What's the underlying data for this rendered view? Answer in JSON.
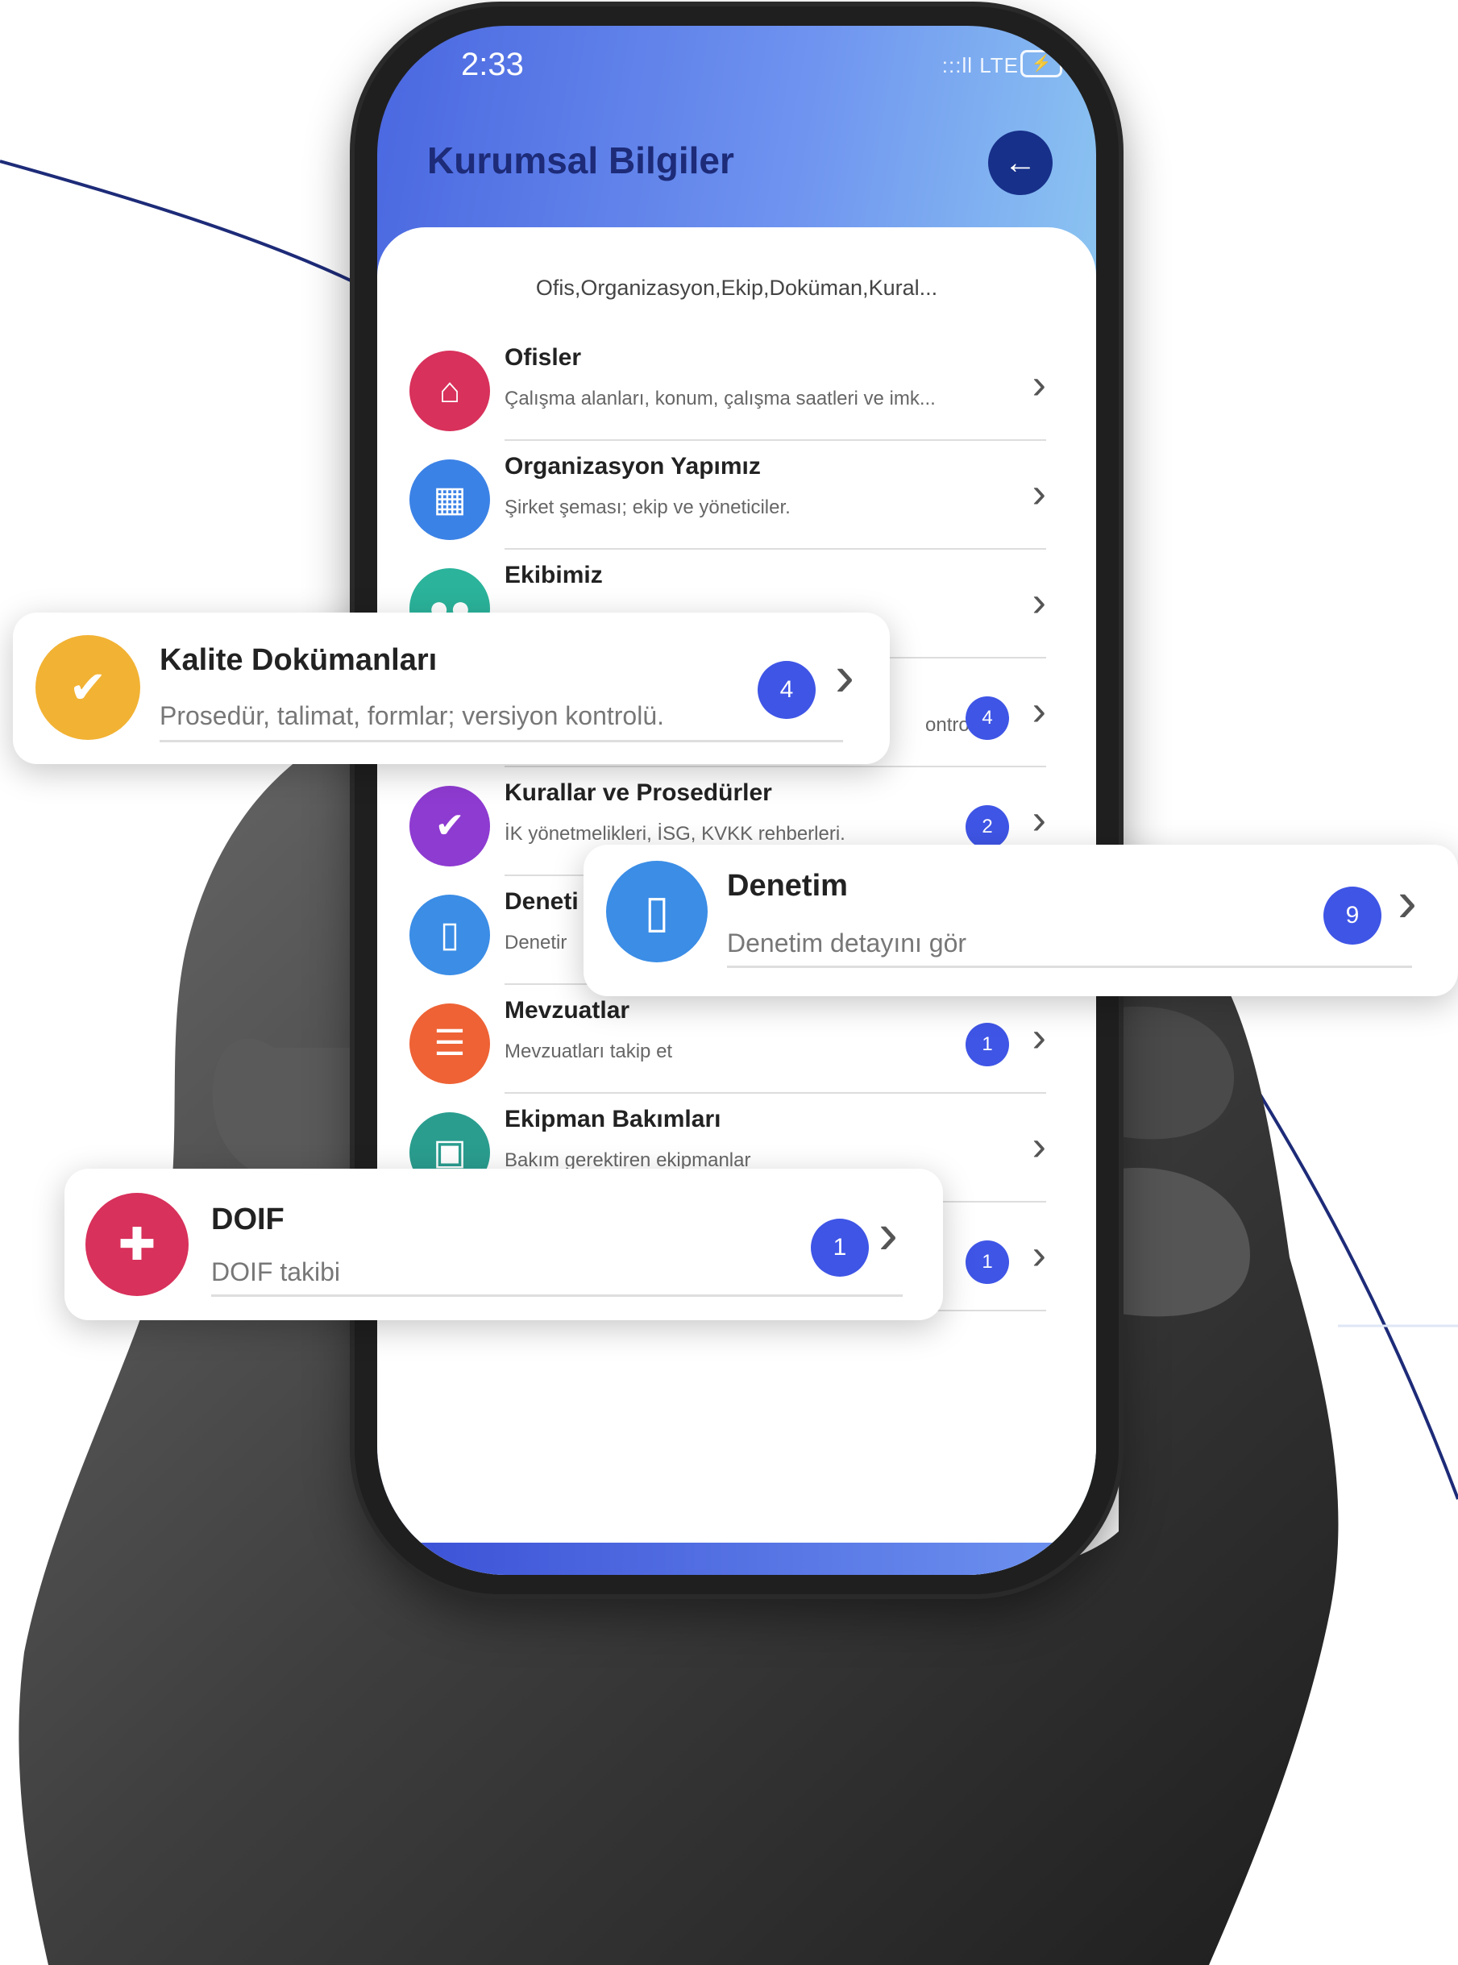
{
  "status_bar": {
    "time": "2:33",
    "signal": ":::ll LTE",
    "battery": "⚡"
  },
  "header": {
    "title": "Kurumsal Bilgiler",
    "back_icon": "←"
  },
  "subtitle": "Ofis,Organizasyon,Ekip,Doküman,Kural...",
  "menu": [
    {
      "title": "Ofisler",
      "desc": "Çalışma alanları, konum, çalışma saatleri ve imk...",
      "icon": "home-icon",
      "color": "#d8315b"
    },
    {
      "title": "Organizasyon Yapımız",
      "desc": "Şirket şeması; ekip ve yöneticiler.",
      "icon": "building-icon",
      "color": "#3b82e6"
    },
    {
      "title": "Ekibimiz",
      "desc": "",
      "icon": "people-icon",
      "color": "#2bb39b"
    },
    {
      "title": "",
      "desc": "ontrolü.",
      "badge": "4",
      "icon": "",
      "color": "#f2b233"
    },
    {
      "title": "Kurallar ve Prosedürler",
      "desc": "İK yönetmelikleri, İSG, KVKK rehberleri.",
      "badge": "2",
      "icon": "check-badge-icon",
      "color": "#8e3bd1"
    },
    {
      "title": "Deneti",
      "desc": "Denetir",
      "icon": "tablet-icon",
      "color": "#3b8de6"
    },
    {
      "title": "Mevzuatlar",
      "desc": "Mevzuatları takip et",
      "badge": "1",
      "icon": "list-icon",
      "color": "#ee6235"
    },
    {
      "title": "Ekipman Bakımları",
      "desc": "Bakım gerektiren ekipmanlar",
      "icon": "briefcase-icon",
      "color": "#2a9d8f"
    },
    {
      "title": "",
      "desc": "",
      "badge": "1",
      "icon": "",
      "color": "#ffffff"
    }
  ],
  "cards": {
    "kalite": {
      "title": "Kalite Dokümanları",
      "desc": "Prosedür, talimat, formlar; versiyon kontrolü.",
      "badge": "4",
      "icon": "check-badge-icon",
      "color": "#f2b233"
    },
    "denetim": {
      "title": "Denetim",
      "desc": "Denetim detayını gör",
      "badge": "9",
      "icon": "tablet-icon",
      "color": "#3b8de6"
    },
    "doif": {
      "title": "DOIF",
      "desc": "DOIF takibi",
      "badge": "1",
      "icon": "shield-plus-icon",
      "color": "#d8315b"
    }
  }
}
